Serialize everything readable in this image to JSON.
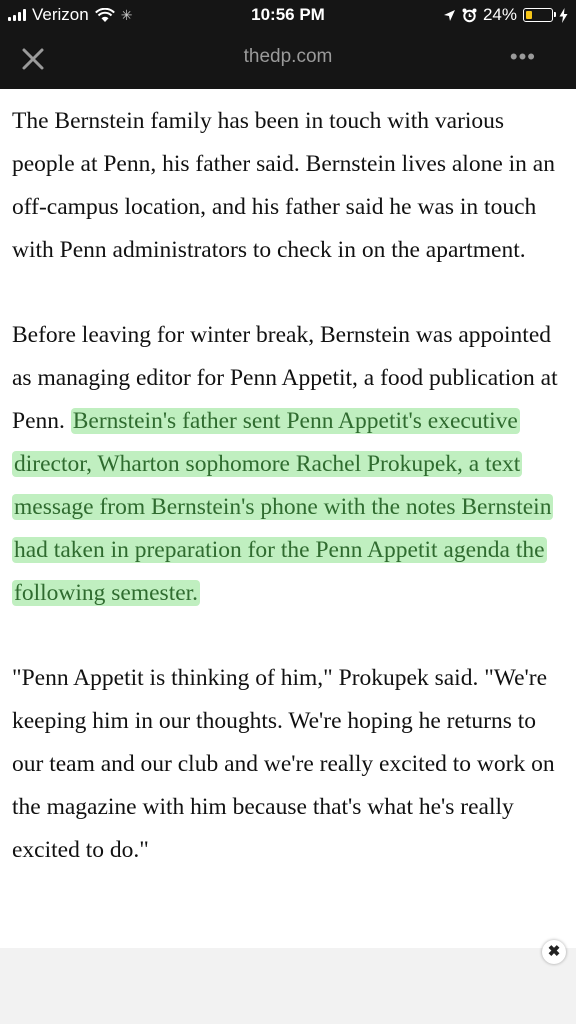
{
  "status_bar": {
    "carrier": "Verizon",
    "time": "10:56 PM",
    "battery": "24%",
    "battery_level": 0.24
  },
  "browser": {
    "url": "thedp.com",
    "close_icon": "close-icon",
    "more_icon": "more-dots-icon"
  },
  "article": {
    "para1": "The Bernstein family has been in touch with various people at Penn, his father said. Bernstein lives alone in an off-campus location, and his father said he was in touch with Penn administrators to check in on the apartment.",
    "para2_plain": "Before leaving for winter break, Bernstein was appointed as managing editor for Penn Appetit, a food publication at Penn. ",
    "para2_highlight": "Bernstein's father sent Penn Appetit's executive director, Wharton sophomore Rachel Prokupek, a text message from Bernstein's phone with the notes Bernstein had taken in preparation for the Penn Appetit agenda the following semester.",
    "para3": "\"Penn Appetit is thinking of him,\" Prokupek said. \"We're keeping him in our thoughts. We're hoping he returns to our team and our club and we're really excited to work on the magazine with him because that's what he's really excited to do.\""
  },
  "ad": {
    "close_label": "✖"
  },
  "colors": {
    "topbar": "#151515",
    "highlight": "#8ce18c",
    "highlight_text": "#2f6b2f"
  }
}
